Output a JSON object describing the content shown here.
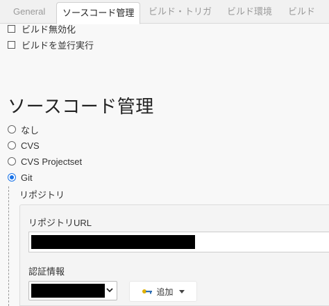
{
  "tabs": [
    {
      "label": "General",
      "active": false
    },
    {
      "label": "ソースコード管理",
      "active": true
    },
    {
      "label": "ビルド・トリガ",
      "active": false
    },
    {
      "label": "ビルド環境",
      "active": false
    },
    {
      "label": "ビルド",
      "active": false
    }
  ],
  "build_options": [
    {
      "label": "ビルド無効化",
      "checked": false
    },
    {
      "label": "ビルドを並行実行",
      "checked": false
    }
  ],
  "scm": {
    "title": "ソースコード管理",
    "options": [
      {
        "label": "なし",
        "selected": false
      },
      {
        "label": "CVS",
        "selected": false
      },
      {
        "label": "CVS Projectset",
        "selected": false
      },
      {
        "label": "Git",
        "selected": true
      }
    ]
  },
  "git": {
    "repository_label": "リポジトリ",
    "url_label": "リポジトリURL",
    "url_value": "",
    "credentials_label": "認証情報",
    "credentials_value": "",
    "add_button_label": "追加"
  },
  "colors": {
    "accent": "#1a73e8",
    "add_key_icon": "#2f6fb3",
    "add_key_icon_secondary": "#e0b000"
  },
  "icons": {
    "credentials_dropdown": "chevron-down-icon",
    "add_button_leading": "key-icon",
    "add_button_trailing": "caret-down-icon"
  }
}
